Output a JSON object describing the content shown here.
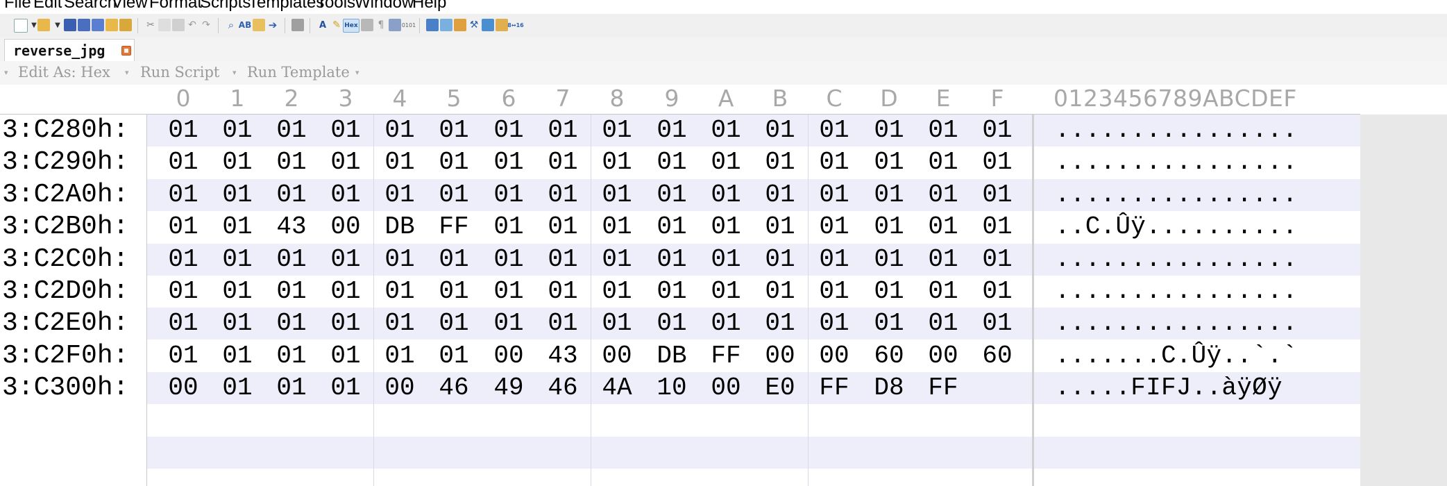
{
  "menu": {
    "items": [
      "File",
      "Edit",
      "Search",
      "View",
      "Format",
      "Scripts",
      "Templates",
      "Tools",
      "Window",
      "Help"
    ]
  },
  "toolbar": {
    "icons": [
      "new-file-icon",
      "open-file-icon",
      "save-icon",
      "save-as-icon",
      "save-all-icon",
      "open-folder-icon",
      "folder-icon",
      "cut-icon",
      "copy-icon",
      "paste-icon",
      "undo-icon",
      "redo-icon",
      "find-icon",
      "find-replace-icon",
      "find-next-icon",
      "goto-icon",
      "print-icon",
      "font-icon",
      "highlight-icon",
      "hex-mode-icon",
      "columns-icon",
      "paragraph-icon",
      "split-view-icon",
      "binary-icon",
      "calculator-icon",
      "compare-icon",
      "checksum-icon",
      "tools-icon",
      "histogram-icon",
      "script-icon",
      "base-convert-icon"
    ],
    "hex_label": "Hex"
  },
  "tab": {
    "title": "reverse_jpg"
  },
  "editbar": {
    "edit_as": "Edit As: Hex",
    "run_script": "Run Script",
    "run_template": "Run Template"
  },
  "hex": {
    "columns": [
      "0",
      "1",
      "2",
      "3",
      "4",
      "5",
      "6",
      "7",
      "8",
      "9",
      "A",
      "B",
      "C",
      "D",
      "E",
      "F"
    ],
    "ascii_header": "0123456789ABCDEF",
    "rows": [
      {
        "addr": "3:C280h:",
        "bytes": [
          "01",
          "01",
          "01",
          "01",
          "01",
          "01",
          "01",
          "01",
          "01",
          "01",
          "01",
          "01",
          "01",
          "01",
          "01",
          "01"
        ],
        "ascii": "................"
      },
      {
        "addr": "3:C290h:",
        "bytes": [
          "01",
          "01",
          "01",
          "01",
          "01",
          "01",
          "01",
          "01",
          "01",
          "01",
          "01",
          "01",
          "01",
          "01",
          "01",
          "01"
        ],
        "ascii": "................"
      },
      {
        "addr": "3:C2A0h:",
        "bytes": [
          "01",
          "01",
          "01",
          "01",
          "01",
          "01",
          "01",
          "01",
          "01",
          "01",
          "01",
          "01",
          "01",
          "01",
          "01",
          "01"
        ],
        "ascii": "................"
      },
      {
        "addr": "3:C2B0h:",
        "bytes": [
          "01",
          "01",
          "43",
          "00",
          "DB",
          "FF",
          "01",
          "01",
          "01",
          "01",
          "01",
          "01",
          "01",
          "01",
          "01",
          "01"
        ],
        "ascii": "..C.Ûÿ.........."
      },
      {
        "addr": "3:C2C0h:",
        "bytes": [
          "01",
          "01",
          "01",
          "01",
          "01",
          "01",
          "01",
          "01",
          "01",
          "01",
          "01",
          "01",
          "01",
          "01",
          "01",
          "01"
        ],
        "ascii": "................"
      },
      {
        "addr": "3:C2D0h:",
        "bytes": [
          "01",
          "01",
          "01",
          "01",
          "01",
          "01",
          "01",
          "01",
          "01",
          "01",
          "01",
          "01",
          "01",
          "01",
          "01",
          "01"
        ],
        "ascii": "................"
      },
      {
        "addr": "3:C2E0h:",
        "bytes": [
          "01",
          "01",
          "01",
          "01",
          "01",
          "01",
          "01",
          "01",
          "01",
          "01",
          "01",
          "01",
          "01",
          "01",
          "01",
          "01"
        ],
        "ascii": "................"
      },
      {
        "addr": "3:C2F0h:",
        "bytes": [
          "01",
          "01",
          "01",
          "01",
          "01",
          "01",
          "00",
          "43",
          "00",
          "DB",
          "FF",
          "00",
          "00",
          "60",
          "00",
          "60"
        ],
        "ascii": ".......C.Ûÿ..`.`"
      },
      {
        "addr": "3:C300h:",
        "bytes": [
          "00",
          "01",
          "01",
          "01",
          "00",
          "46",
          "49",
          "46",
          "4A",
          "10",
          "00",
          "E0",
          "FF",
          "D8",
          "FF"
        ],
        "ascii": ".....FIFJ..àÿØÿ"
      }
    ]
  },
  "colors": {
    "row_stripe": "#eeeefb",
    "row_plain": "#ffffff",
    "header_text": "#a8a8a8",
    "hex_mode_bg": "#cfe3f7"
  }
}
